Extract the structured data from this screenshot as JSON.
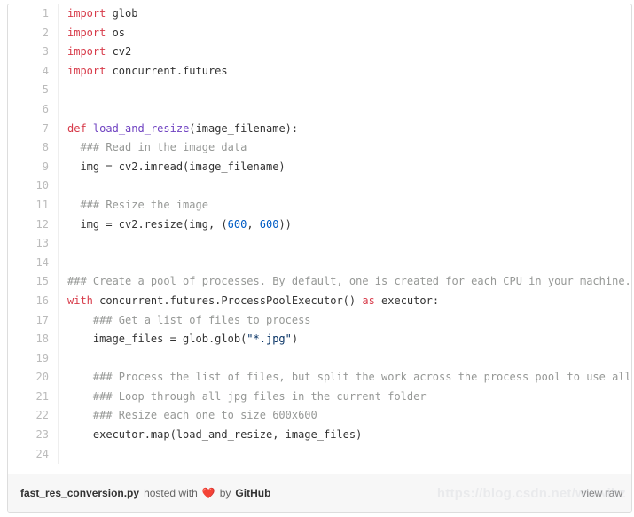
{
  "embed": {
    "filename": "fast_res_conversion.py",
    "hosted_with_text": "hosted with",
    "heart_icon": "heart-icon",
    "by_text": "by",
    "host_name": "GitHub",
    "view_raw_label": "view raw",
    "watermark": "https://blog.csdn.net/wwwihz",
    "border_color": "#dddddd",
    "footer_bg": "#f7f7f7",
    "accent_heart": "#e25555"
  },
  "syntax_colors": {
    "keyword": "#d73a49",
    "function": "#6f42c1",
    "number": "#005cc5",
    "string": "#032f62",
    "comment": "#969896",
    "plain": "#333333",
    "line_number": "#bbbbbb"
  },
  "code": {
    "language": "python",
    "first_line": 1,
    "last_line": 24,
    "lines": [
      {
        "n": "1",
        "tokens": [
          {
            "t": "import",
            "c": "kw"
          },
          {
            "t": " glob",
            "c": "pln"
          }
        ]
      },
      {
        "n": "2",
        "tokens": [
          {
            "t": "import",
            "c": "kw"
          },
          {
            "t": " os",
            "c": "pln"
          }
        ]
      },
      {
        "n": "3",
        "tokens": [
          {
            "t": "import",
            "c": "kw"
          },
          {
            "t": " cv2",
            "c": "pln"
          }
        ]
      },
      {
        "n": "4",
        "tokens": [
          {
            "t": "import",
            "c": "kw"
          },
          {
            "t": " concurrent.futures",
            "c": "pln"
          }
        ]
      },
      {
        "n": "5",
        "tokens": []
      },
      {
        "n": "6",
        "tokens": []
      },
      {
        "n": "7",
        "tokens": [
          {
            "t": "def",
            "c": "kw"
          },
          {
            "t": " ",
            "c": "pln"
          },
          {
            "t": "load_and_resize",
            "c": "fn"
          },
          {
            "t": "(image_filename):",
            "c": "pln"
          }
        ]
      },
      {
        "n": "8",
        "tokens": [
          {
            "t": "  ### Read in the image data",
            "c": "com"
          }
        ]
      },
      {
        "n": "9",
        "tokens": [
          {
            "t": "  img = cv2.imread(image_filename)",
            "c": "pln"
          }
        ]
      },
      {
        "n": "10",
        "tokens": []
      },
      {
        "n": "11",
        "tokens": [
          {
            "t": "  ### Resize the image",
            "c": "com"
          }
        ]
      },
      {
        "n": "12",
        "tokens": [
          {
            "t": "  img = cv2.resize(img, (",
            "c": "pln"
          },
          {
            "t": "600",
            "c": "num"
          },
          {
            "t": ", ",
            "c": "pln"
          },
          {
            "t": "600",
            "c": "num"
          },
          {
            "t": "))",
            "c": "pln"
          }
        ]
      },
      {
        "n": "13",
        "tokens": []
      },
      {
        "n": "14",
        "tokens": []
      },
      {
        "n": "15",
        "tokens": [
          {
            "t": "### Create a pool of processes. By default, one is created for each CPU in your machine.",
            "c": "com"
          }
        ]
      },
      {
        "n": "16",
        "tokens": [
          {
            "t": "with",
            "c": "kw"
          },
          {
            "t": " concurrent.futures.ProcessPoolExecutor() ",
            "c": "pln"
          },
          {
            "t": "as",
            "c": "kw"
          },
          {
            "t": " executor:",
            "c": "pln"
          }
        ]
      },
      {
        "n": "17",
        "tokens": [
          {
            "t": "    ### Get a list of files to process",
            "c": "com"
          }
        ]
      },
      {
        "n": "18",
        "tokens": [
          {
            "t": "    image_files = glob.glob(",
            "c": "pln"
          },
          {
            "t": "\"*.jpg\"",
            "c": "str"
          },
          {
            "t": ")",
            "c": "pln"
          }
        ]
      },
      {
        "n": "19",
        "tokens": []
      },
      {
        "n": "20",
        "tokens": [
          {
            "t": "    ### Process the list of files, but split the work across the process pool to use all CPUs!",
            "c": "com"
          }
        ]
      },
      {
        "n": "21",
        "tokens": [
          {
            "t": "    ### Loop through all jpg files in the current folder",
            "c": "com"
          }
        ]
      },
      {
        "n": "22",
        "tokens": [
          {
            "t": "    ### Resize each one to size 600x600",
            "c": "com"
          }
        ]
      },
      {
        "n": "23",
        "tokens": [
          {
            "t": "    executor.map(load_and_resize, image_files)",
            "c": "pln"
          }
        ]
      },
      {
        "n": "24",
        "tokens": []
      }
    ]
  }
}
